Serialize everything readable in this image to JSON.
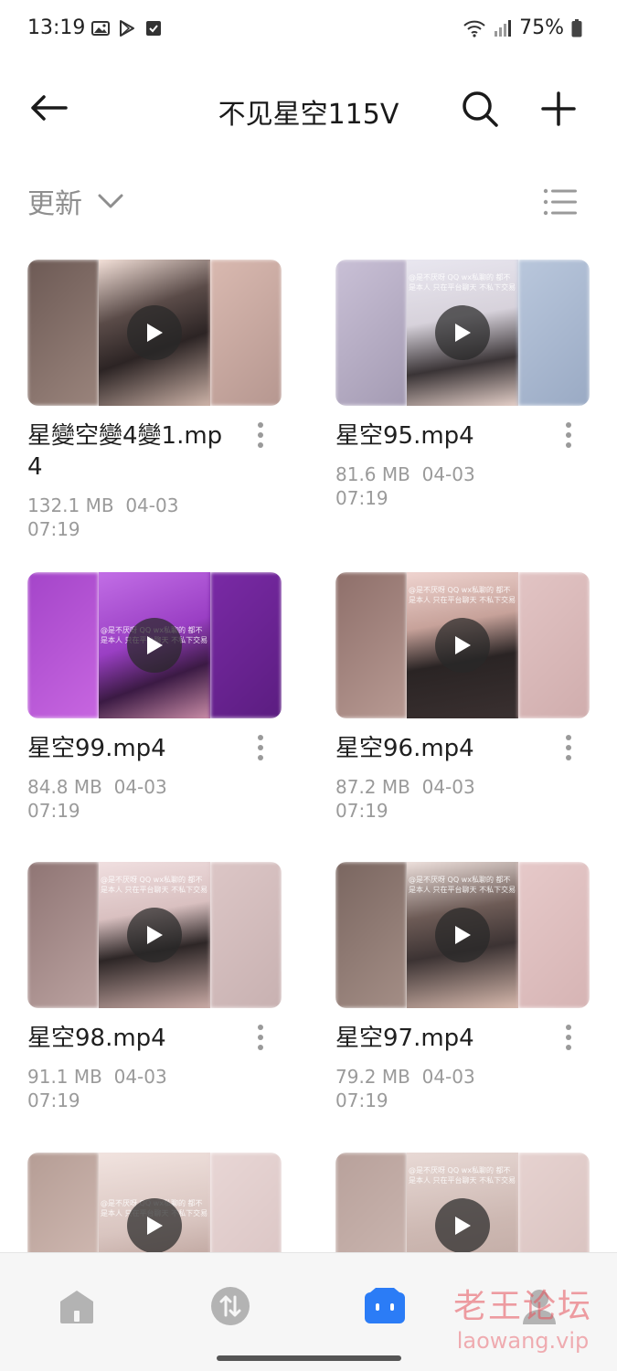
{
  "status_bar": {
    "time": "13:19",
    "battery": "75%"
  },
  "header": {
    "title": "不见星空115V"
  },
  "sort": {
    "label": "更新"
  },
  "files": [
    {
      "name": "星變空變4變1.mp4",
      "size": "132.1 MB",
      "date": "04-03",
      "time": "07:19"
    },
    {
      "name": "星空95.mp4",
      "size": "81.6 MB",
      "date": "04-03",
      "time": "07:19"
    },
    {
      "name": "星空99.mp4",
      "size": "84.8 MB",
      "date": "04-03",
      "time": "07:19"
    },
    {
      "name": "星空96.mp4",
      "size": "87.2 MB",
      "date": "04-03",
      "time": "07:19"
    },
    {
      "name": "星空98.mp4",
      "size": "91.1 MB",
      "date": "04-03",
      "time": "07:19"
    },
    {
      "name": "星空97.mp4",
      "size": "79.2 MB",
      "date": "04-03",
      "time": "07:19"
    }
  ],
  "thumb_overlay_text": "@是不厌呀 QQ wx私聊的 都不是本人 只在平台聊天 不私下交易",
  "watermark": {
    "cn": "老王论坛",
    "en": "laowang.vip"
  },
  "colors": {
    "accent": "#2b7cf6",
    "nav_inactive": "#b3b3b3",
    "meta_text": "#9a9a9a"
  },
  "icons": {
    "back": "arrow-left-icon",
    "search": "search-icon",
    "add": "plus-icon",
    "sort": "chevron-down-icon",
    "list_view": "list-icon",
    "more": "more-vertical-icon",
    "nav_home": "home-icon",
    "nav_transfer": "transfer-icon",
    "nav_files": "files-icon",
    "nav_profile": "profile-icon"
  }
}
